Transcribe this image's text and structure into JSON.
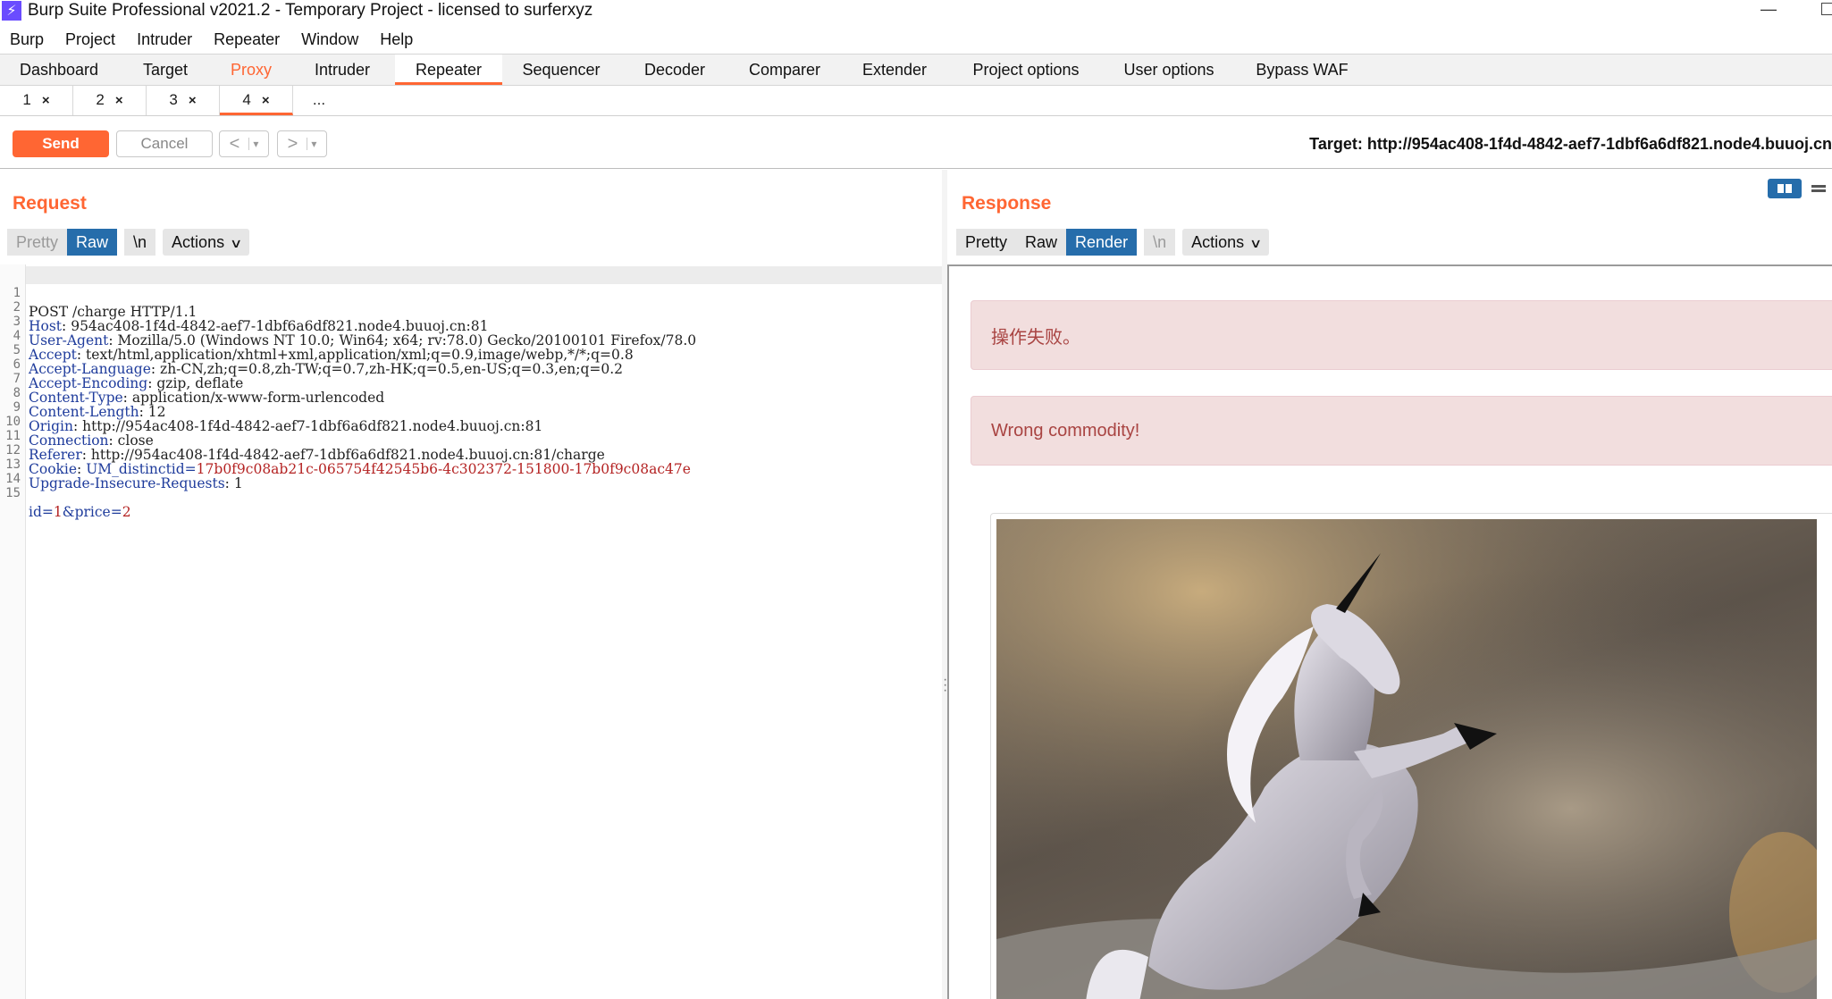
{
  "window": {
    "title": "Burp Suite Professional v2021.2 - Temporary Project - licensed to surferxyz",
    "minimize_glyph": "—"
  },
  "menubar": [
    "Burp",
    "Project",
    "Intruder",
    "Repeater",
    "Window",
    "Help"
  ],
  "tool_tabs": [
    "Dashboard",
    "Target",
    "Proxy",
    "Intruder",
    "Repeater",
    "Sequencer",
    "Decoder",
    "Comparer",
    "Extender",
    "Project options",
    "User options",
    "Bypass WAF"
  ],
  "active_tool_tab": "Repeater",
  "highlighted_tool_tab": "Proxy",
  "sub_tabs": [
    {
      "label": "1",
      "close": "×"
    },
    {
      "label": "2",
      "close": "×"
    },
    {
      "label": "3",
      "close": "×"
    },
    {
      "label": "4",
      "close": "×"
    },
    {
      "label": "...",
      "close": ""
    }
  ],
  "active_sub_tab": "4",
  "toolbar": {
    "send_label": "Send",
    "cancel_label": "Cancel",
    "back_glyph": "<",
    "forward_glyph": ">",
    "dropdown_glyph": "▾",
    "target_label": "Target: http://954ac408-1f4d-4842-aef7-1dbf6a6df821.node4.buuoj.cn"
  },
  "request": {
    "title": "Request",
    "view_buttons": [
      "Pretty",
      "Raw",
      "\\n"
    ],
    "selected_view": "Raw",
    "actions_label": "Actions",
    "lines": [
      {
        "n": "1",
        "key": "",
        "val": "POST /charge HTTP/1.1"
      },
      {
        "n": "2",
        "key": "Host",
        "val": " 954ac408-1f4d-4842-aef7-1dbf6a6df821.node4.buuoj.cn:81"
      },
      {
        "n": "3",
        "key": "User-Agent",
        "val": " Mozilla/5.0 (Windows NT 10.0; Win64; x64; rv:78.0) Gecko/20100101 Firefox/78.0"
      },
      {
        "n": "4",
        "key": "Accept",
        "val": " text/html,application/xhtml+xml,application/xml;q=0.9,image/webp,*/*;q=0.8"
      },
      {
        "n": "5",
        "key": "Accept-Language",
        "val": " zh-CN,zh;q=0.8,zh-TW;q=0.7,zh-HK;q=0.5,en-US;q=0.3,en;q=0.2"
      },
      {
        "n": "6",
        "key": "Accept-Encoding",
        "val": " gzip, deflate"
      },
      {
        "n": "7",
        "key": "Content-Type",
        "val": " application/x-www-form-urlencoded"
      },
      {
        "n": "8",
        "key": "Content-Length",
        "val": " 12"
      },
      {
        "n": "9",
        "key": "Origin",
        "val": " http://954ac408-1f4d-4842-aef7-1dbf6a6df821.node4.buuoj.cn:81"
      },
      {
        "n": "10",
        "key": "Connection",
        "val": " close"
      },
      {
        "n": "11",
        "key": "Referer",
        "val": " http://954ac408-1f4d-4842-aef7-1dbf6a6df821.node4.buuoj.cn:81/charge"
      },
      {
        "n": "12",
        "key": "Cookie",
        "val": " UM_distinctid=",
        "cookie_value": "17b0f9c08ab21c-065754f42545b6-4c302372-151800-17b0f9c08ac47e"
      },
      {
        "n": "13",
        "key": "Upgrade-Insecure-Requests",
        "val": " 1"
      },
      {
        "n": "14",
        "key": "",
        "val": ""
      },
      {
        "n": "15",
        "key": "",
        "val": "",
        "body_key1": "id",
        "body_val1": "1",
        "body_key2": "price",
        "body_val2": "2"
      }
    ]
  },
  "response": {
    "title": "Response",
    "view_buttons": [
      "Pretty",
      "Raw",
      "Render",
      "\\n"
    ],
    "selected_view": "Render",
    "actions_label": "Actions",
    "alerts": [
      "操作失败。",
      "Wrong commodity!"
    ],
    "image_subject": "unicorn-image"
  },
  "colors": {
    "accent": "#ff6633",
    "selected_button": "#266dab",
    "header_key": "#1f3c9c",
    "cookie_value": "#b42323",
    "alert_bg": "#f2dede",
    "alert_text": "#a94442"
  }
}
